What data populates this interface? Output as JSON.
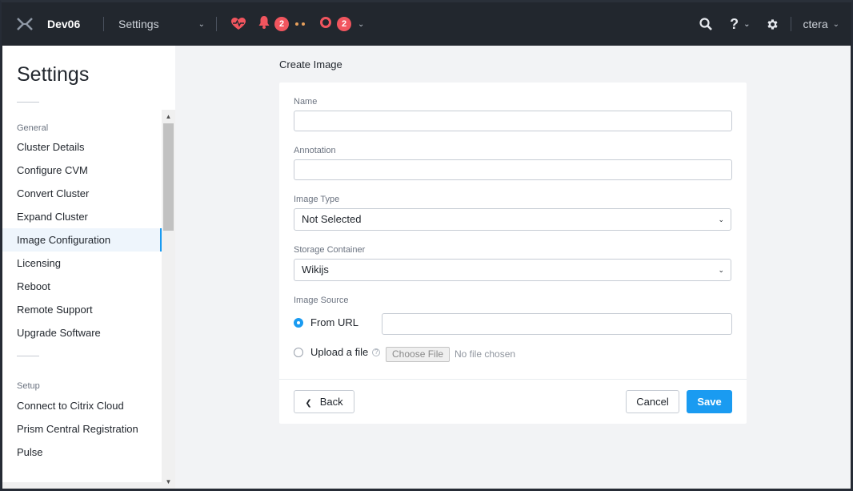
{
  "topbar": {
    "cluster_name": "Dev06",
    "nav_label": "Settings",
    "alerts_count": "2",
    "tasks_count": "2",
    "help_label": "?",
    "user_name": "ctera"
  },
  "sidebar": {
    "title": "Settings",
    "groups": [
      {
        "label": "General",
        "items": [
          {
            "label": "Cluster Details"
          },
          {
            "label": "Configure CVM"
          },
          {
            "label": "Convert Cluster"
          },
          {
            "label": "Expand Cluster"
          },
          {
            "label": "Image Configuration",
            "active": true
          },
          {
            "label": "Licensing"
          },
          {
            "label": "Reboot"
          },
          {
            "label": "Remote Support"
          },
          {
            "label": "Upgrade Software"
          }
        ]
      },
      {
        "label": "Setup",
        "items": [
          {
            "label": "Connect to Citrix Cloud"
          },
          {
            "label": "Prism Central Registration"
          },
          {
            "label": "Pulse"
          }
        ]
      }
    ]
  },
  "form": {
    "page_title": "Create Image",
    "name_label": "Name",
    "name_value": "",
    "annotation_label": "Annotation",
    "annotation_value": "",
    "image_type_label": "Image Type",
    "image_type_value": "Not Selected",
    "storage_container_label": "Storage Container",
    "storage_container_value": "Wikijs",
    "image_source_label": "Image Source",
    "from_url_label": "From URL",
    "url_value": "",
    "upload_file_label": "Upload a file",
    "choose_file_label": "Choose File",
    "file_status": "No file chosen",
    "back_label": "Back",
    "cancel_label": "Cancel",
    "save_label": "Save"
  },
  "colors": {
    "accent": "#1a9bf1",
    "badge": "#f1555e",
    "topbar": "#22272e"
  }
}
